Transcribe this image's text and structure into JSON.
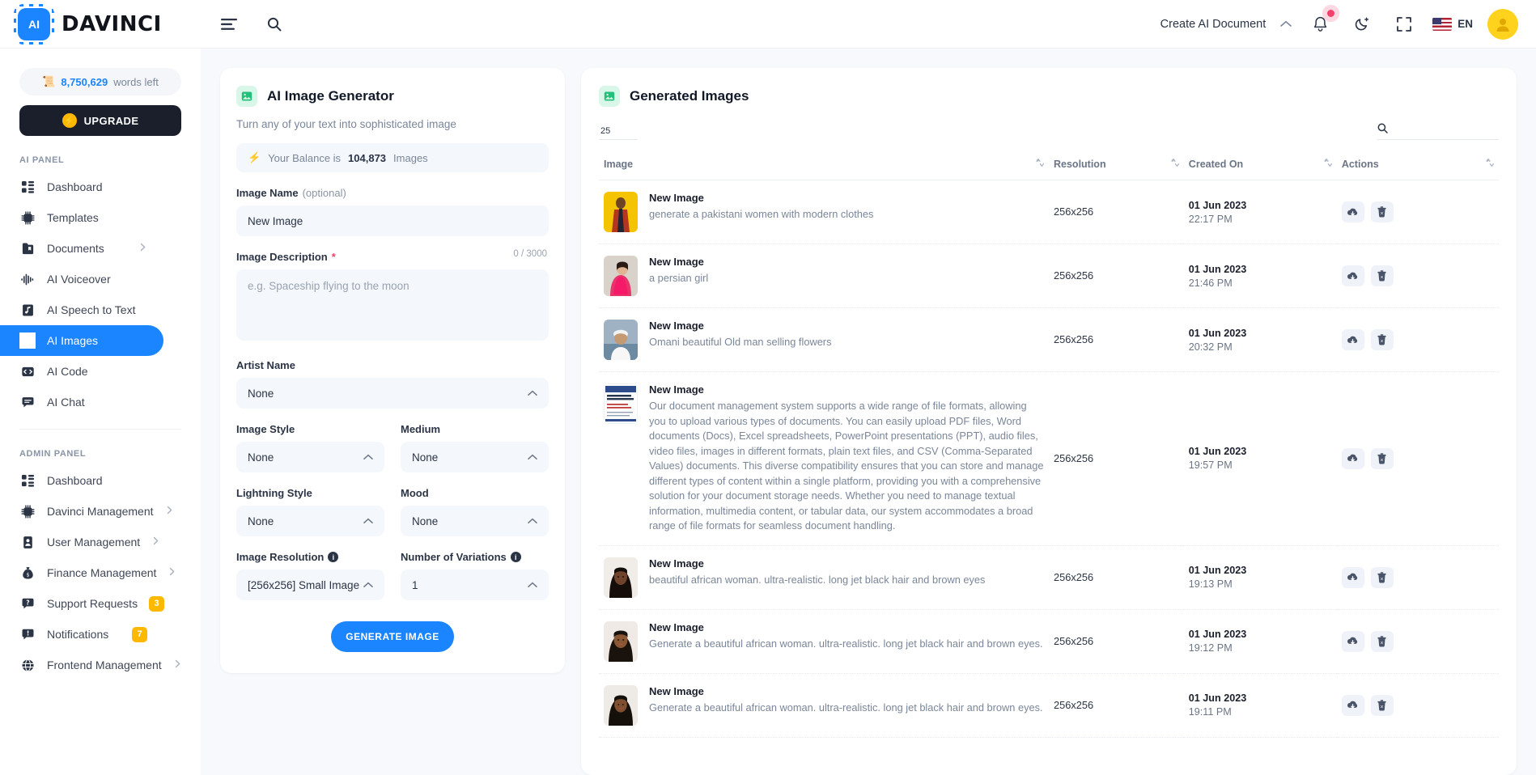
{
  "brand": {
    "logo_text": "AI",
    "name": "DAVINCI",
    "logo_icon": "ai-chip-icon"
  },
  "topbar": {
    "menu_icon": "hamburger-menu-icon",
    "search_icon": "search-icon",
    "create_document": "Create AI Document",
    "chevron_icon": "chevron-up-icon",
    "bell_icon": "bell-icon",
    "dark_mode_icon": "moon-icon",
    "fullscreen_icon": "fullscreen-icon",
    "language": "EN",
    "flag_icon": "us-flag-icon",
    "avatar_icon": "user-avatar"
  },
  "sidebar": {
    "words_left_count": "8,750,629",
    "words_left_label": "words left",
    "upgrade_label": "UPGRADE",
    "ai_panel_title": "AI PANEL",
    "admin_panel_title": "ADMIN PANEL",
    "ai_items": [
      {
        "label": "Dashboard",
        "icon": "dashboard-icon",
        "active": false,
        "chevron": false
      },
      {
        "label": "Templates",
        "icon": "chip-icon",
        "active": false,
        "chevron": false
      },
      {
        "label": "Documents",
        "icon": "documents-icon",
        "active": false,
        "chevron": true
      },
      {
        "label": "AI Voiceover",
        "icon": "waveform-icon",
        "active": false,
        "chevron": false
      },
      {
        "label": "AI Speech to Text",
        "icon": "audio-file-icon",
        "active": false,
        "chevron": false
      },
      {
        "label": "AI Images",
        "icon": "image-scan-icon",
        "active": true,
        "chevron": false
      },
      {
        "label": "AI Code",
        "icon": "code-icon",
        "active": false,
        "chevron": false
      },
      {
        "label": "AI Chat",
        "icon": "chat-icon",
        "active": false,
        "chevron": false
      }
    ],
    "admin_items": [
      {
        "label": "Dashboard",
        "icon": "dashboard-icon",
        "chevron": false,
        "badge": ""
      },
      {
        "label": "Davinci Management",
        "icon": "chip-icon",
        "chevron": true,
        "badge": ""
      },
      {
        "label": "User Management",
        "icon": "user-card-icon",
        "chevron": true,
        "badge": ""
      },
      {
        "label": "Finance Management",
        "icon": "money-bag-icon",
        "chevron": true,
        "badge": ""
      },
      {
        "label": "Support Requests",
        "icon": "question-bubble-icon",
        "chevron": false,
        "badge": "3"
      },
      {
        "label": "Notifications",
        "icon": "alert-bubble-icon",
        "chevron": false,
        "badge": "7"
      },
      {
        "label": "Frontend Management",
        "icon": "globe-icon",
        "chevron": true,
        "badge": ""
      }
    ]
  },
  "generator": {
    "icon": "image-icon",
    "title": "AI Image Generator",
    "subtitle": "Turn any of your text into sophisticated image",
    "balance_prefix": "Your Balance is",
    "balance_value": "104,873",
    "balance_suffix": "Images",
    "image_name_label": "Image Name",
    "image_name_optional": "(optional)",
    "image_name_value": "New Image",
    "image_desc_label": "Image Description",
    "image_desc_placeholder": "e.g. Spaceship flying to the moon",
    "image_desc_counter": "0 / 3000",
    "artist_label": "Artist Name",
    "artist_value": "None",
    "style_label": "Image Style",
    "style_value": "None",
    "medium_label": "Medium",
    "medium_value": "None",
    "lightning_label": "Lightning Style",
    "lightning_value": "None",
    "mood_label": "Mood",
    "mood_value": "None",
    "resolution_label": "Image Resolution",
    "resolution_value": "[256x256] Small Image",
    "variations_label": "Number of Variations",
    "variations_value": "1",
    "generate_label": "GENERATE IMAGE"
  },
  "table": {
    "icon": "image-icon",
    "title": "Generated Images",
    "page_size": "25",
    "search_placeholder": "",
    "search_icon": "search-icon",
    "columns": [
      "Image",
      "Resolution",
      "Created On",
      "Actions"
    ],
    "download_icon": "cloud-download-icon",
    "delete_icon": "trash-icon",
    "rows": [
      {
        "title": "New Image",
        "desc": "generate a pakistani women with modern clothes",
        "resolution": "256x256",
        "date": "01 Jun 2023",
        "time": "22:17 PM",
        "thumb": "pakistani-woman-yellow"
      },
      {
        "title": "New Image",
        "desc": "a persian girl",
        "resolution": "256x256",
        "date": "01 Jun 2023",
        "time": "21:46 PM",
        "thumb": "persian-girl-pink"
      },
      {
        "title": "New Image",
        "desc": "Omani beautiful Old man selling flowers",
        "resolution": "256x256",
        "date": "01 Jun 2023",
        "time": "20:32 PM",
        "thumb": "omani-old-man"
      },
      {
        "title": "New Image",
        "desc": "Our document management system supports a wide range of file formats, allowing you to upload various types of documents. You can easily upload PDF files, Word documents (Docs), Excel spreadsheets, PowerPoint presentations (PPT), audio files, video files, images in different formats, plain text files, and CSV (Comma-Separated Values) documents. This diverse compatibility ensures that you can store and manage different types of content within a single platform, providing you with a comprehensive solution for your document storage needs. Whether you need to manage textual information, multimedia content, or tabular data, our system accommodates a broad range of file formats for seamless document handling.",
        "resolution": "256x256",
        "date": "01 Jun 2023",
        "time": "19:57 PM",
        "thumb": "document-poster"
      },
      {
        "title": "New Image",
        "desc": "beautiful african woman. ultra-realistic. long jet black hair and brown eyes",
        "resolution": "256x256",
        "date": "01 Jun 2023",
        "time": "19:13 PM",
        "thumb": "african-woman-1"
      },
      {
        "title": "New Image",
        "desc": "Generate a beautiful african woman. ultra-realistic. long jet black hair and brown eyes.",
        "resolution": "256x256",
        "date": "01 Jun 2023",
        "time": "19:12 PM",
        "thumb": "african-woman-2"
      },
      {
        "title": "New Image",
        "desc": "Generate a beautiful african woman. ultra-realistic. long jet black hair and brown eyes.",
        "resolution": "256x256",
        "date": "01 Jun 2023",
        "time": "19:11 PM",
        "thumb": "african-woman-3"
      }
    ]
  },
  "colors": {
    "accent": "#1b84ff",
    "badge": "#ffb800",
    "green": "#22c17b",
    "dark": "#1b1f2c",
    "notification_dot": "#f1416c"
  }
}
